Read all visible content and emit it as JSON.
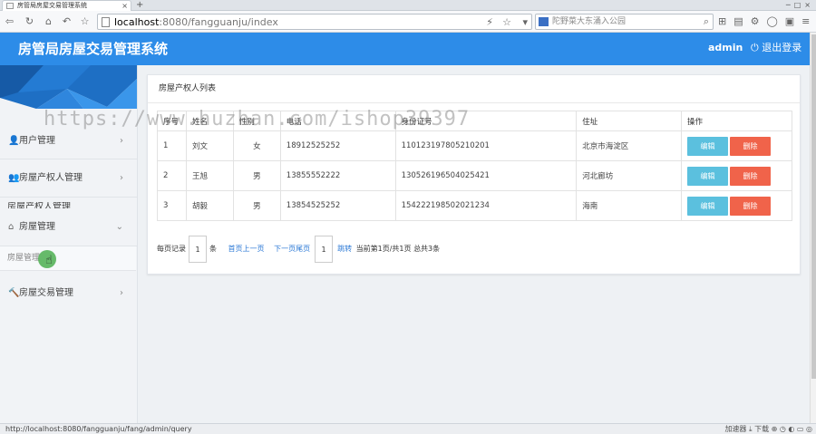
{
  "browser": {
    "tab_title": "房管局房屋交易管理系统",
    "tab_close": "×",
    "new_tab": "+",
    "url_host": "localhost",
    "url_rest": ":8080/fangguanju/index",
    "search_placeholder": "陀野菜大东涌入公园",
    "status_url": "http://localhost:8080/fangguanju/fang/admin/query",
    "status_speed": "加速器",
    "status_download": "下载"
  },
  "header": {
    "title": "房管局房屋交易管理系统",
    "user": "admin",
    "logout": "退出登录",
    "bg_color": "#2d8ce8"
  },
  "sidebar": {
    "items": [
      {
        "label": "用户管理",
        "icon": "user-icon"
      },
      {
        "label": "房屋产权人管理",
        "icon": "user-group-icon"
      },
      {
        "label": "房屋管理",
        "icon": "home-icon"
      },
      {
        "label": "房屋交易管理",
        "icon": "gavel-icon"
      }
    ],
    "peek_label": "房屋产权人管理",
    "active_sub": "房屋管理"
  },
  "panel": {
    "title": "房屋产权人列表",
    "columns": [
      "序号",
      "姓名",
      "性别",
      "电话",
      "身份证号",
      "住址",
      "操作"
    ],
    "rows": [
      {
        "no": "1",
        "name": "刘文",
        "gender": "女",
        "phone": "18912525252",
        "id": "110123197805210201",
        "addr": "北京市海淀区"
      },
      {
        "no": "2",
        "name": "王旭",
        "gender": "男",
        "phone": "13855552222",
        "id": "130526196504025421",
        "addr": "河北廊坊"
      },
      {
        "no": "3",
        "name": "胡毅",
        "gender": "男",
        "phone": "13854525252",
        "id": "154222198502021234",
        "addr": "海南"
      }
    ],
    "edit_label": "编辑",
    "delete_label": "删除",
    "edit_color": "#5bc0de",
    "delete_color": "#f0634a"
  },
  "pager": {
    "per_page_label": "每页记录",
    "per_page_value": "1",
    "unit": "条",
    "first_prev": "首页上一页",
    "next_last": "下一页尾页",
    "jump_value": "1",
    "jump": "跳转",
    "current": "当前第1页/共1页",
    "total": "总共3条"
  },
  "watermark": "https://www.huzhan.com/ishop39397"
}
